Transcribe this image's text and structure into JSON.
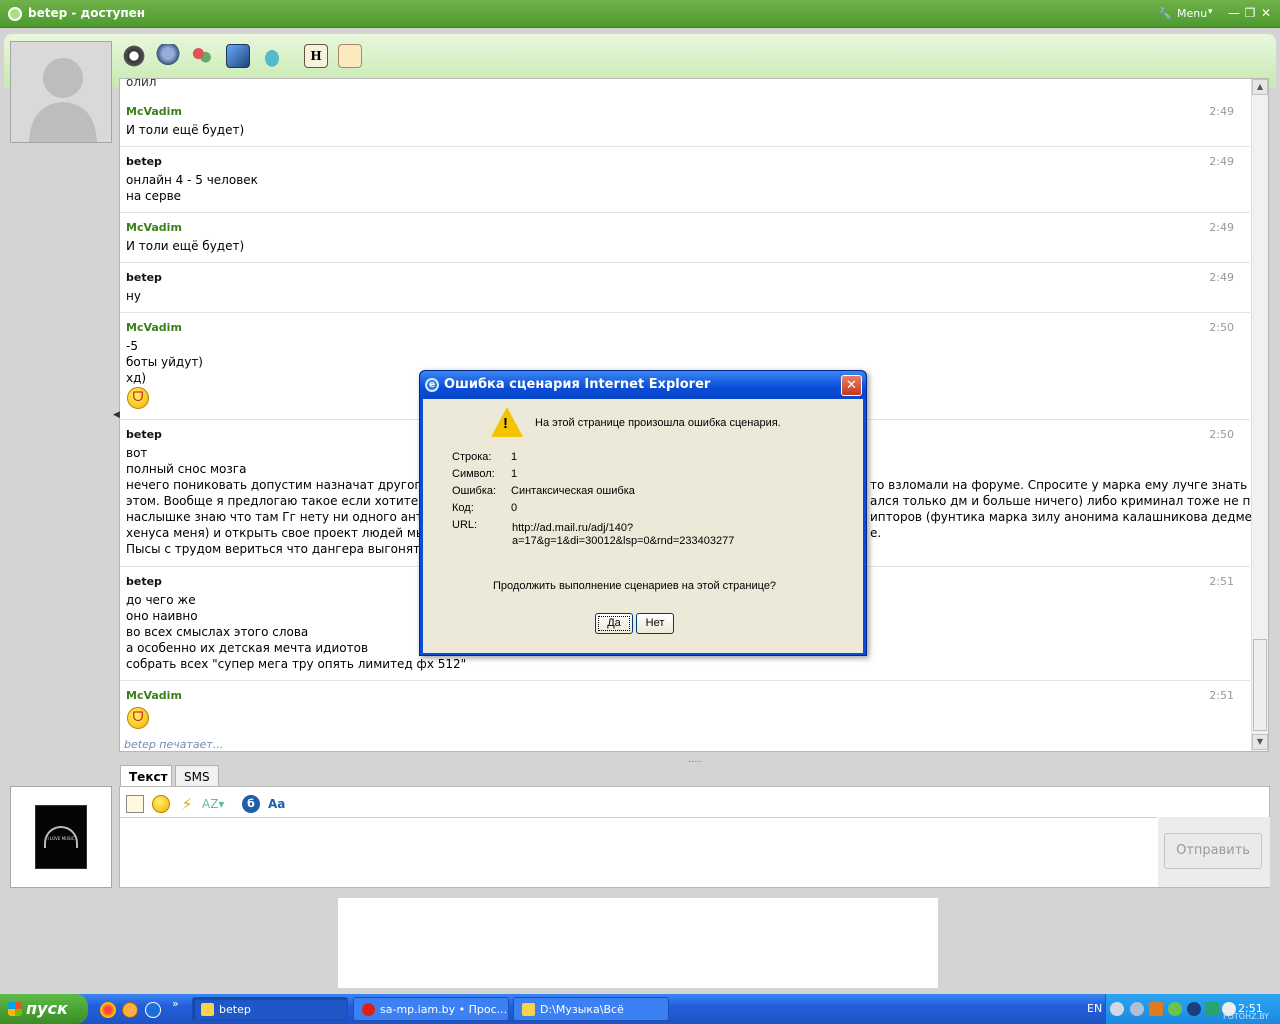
{
  "window": {
    "title": "betep - доступен",
    "menu_label": "Menu",
    "minimize_glyph": "—",
    "maximize_glyph": "❐",
    "close_glyph": "✕"
  },
  "chat": {
    "partial_top_text": "олил",
    "messages": [
      {
        "nick": "McVadim",
        "time": "2:49",
        "lines": [
          "И толи ещё будет)"
        ]
      },
      {
        "nick": "betep",
        "time": "2:49",
        "lines": [
          "онлайн 4 - 5 человек",
          "на серве"
        ]
      },
      {
        "nick": "McVadim",
        "time": "2:49",
        "lines": [
          "И толи ещё будет)"
        ]
      },
      {
        "nick": "betep",
        "time": "2:49",
        "lines": [
          "ну"
        ]
      },
      {
        "nick": "McVadim",
        "time": "2:50",
        "lines": [
          "-5",
          "боты уйдут)",
          "хд)"
        ]
      },
      {
        "nick": "betep",
        "time": "2:50",
        "lines": [
          "вот",
          "полный снос мозга",
          "нечего пониковать допустим назначат другоггла",
          "этом. Вообще я предлогаю такое если хотите ид",
          "наслышке знаю что там Гг нету ни одного античи",
          "хенуса меня) и открыть свое проект людей мы то",
          "Пысы с трудом вериться что дангера выгонят."
        ],
        "right_fragments": [
          "то взломали на форуме. Спросите у марка ему лучге знать об",
          "ался только дм и больше ничего) либо криминал тоже не по",
          "ипторов (фунтика марка зилу анонима калашникова дедмена",
          "е."
        ]
      },
      {
        "nick": "betep",
        "time": "2:51",
        "lines": [
          "до чего же",
          "оно наивно",
          "во всех смыслах этого слова",
          "а особенно их детская мечта идиотов",
          "собрать всех \"супер мега тру опять лимитед фх 512\""
        ]
      },
      {
        "nick": "McVadim",
        "time": "2:51",
        "lines": []
      }
    ],
    "typing_text": "betep печатает..."
  },
  "composer": {
    "tabs": [
      "Текст",
      "SMS"
    ],
    "send_label": "Отправить",
    "avatar_caption": "I LOVE MUSIC"
  },
  "dialog": {
    "title": "Ошибка сценария Internet Explorer",
    "message": "На этой странице произошла ошибка сценария.",
    "rows": [
      {
        "label": "Строка:",
        "value": "1"
      },
      {
        "label": "Символ:",
        "value": "1"
      },
      {
        "label": "Ошибка:",
        "value": "Синтаксическая ошибка"
      },
      {
        "label": "Код:",
        "value": "0"
      },
      {
        "label": "URL:",
        "value": "http://ad.mail.ru/adj/140?"
      }
    ],
    "url_line2": "a=17&g=1&di=30012&lsp=0&rnd=233403277",
    "question": "Продолжить выполнение сценариев на этой странице?",
    "yes_label": "Да",
    "no_label": "Нет"
  },
  "taskbar": {
    "start_label": "пуск",
    "tasks": [
      "betep",
      "sa-mp.iam.by • Прос...",
      "D:\\Музыка\\Всё"
    ],
    "language": "EN",
    "clock": "2:51",
    "watermark": "FOTOHZ.BY"
  }
}
